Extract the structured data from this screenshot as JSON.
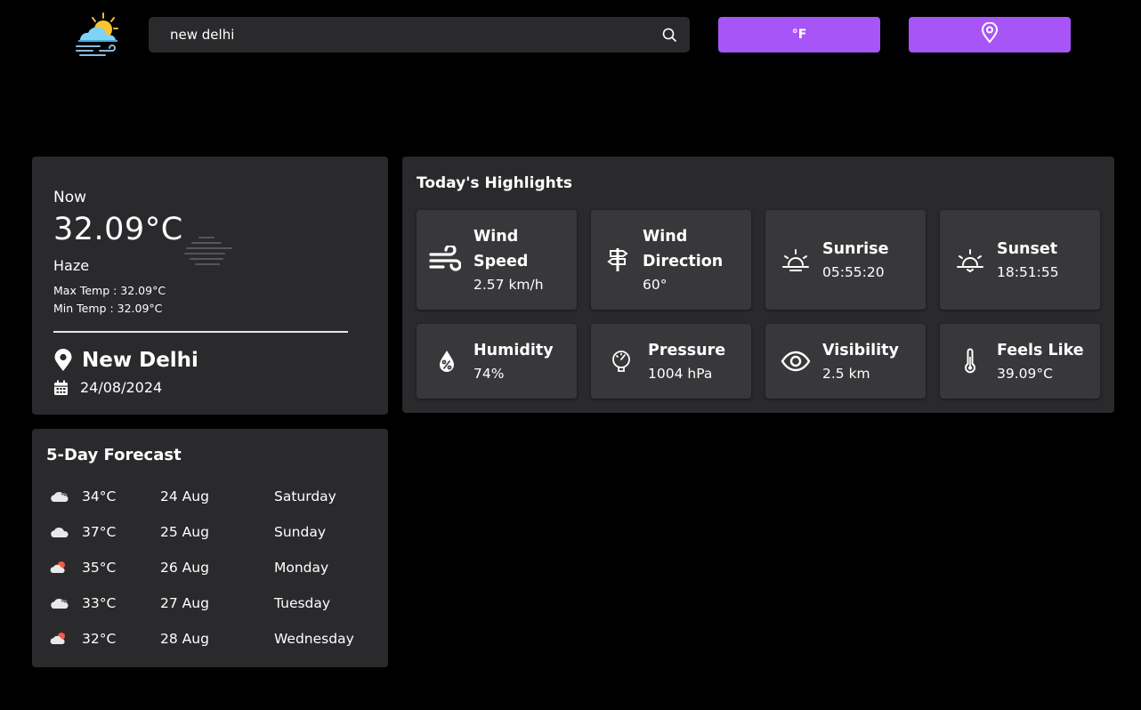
{
  "header": {
    "logo_icon": "weather-logo-icon",
    "search": {
      "value": "new delhi",
      "icon": "search-icon"
    },
    "unit_button_label": "°F",
    "location_button_icon": "map-pin-icon"
  },
  "current": {
    "now_label": "Now",
    "temperature": "32.09°C",
    "condition": "Haze",
    "condition_icon": "haze-icon",
    "max_temp": "Max Temp : 32.09°C",
    "min_temp": "Min Temp : 32.09°C",
    "city": "New Delhi",
    "date": "24/08/2024"
  },
  "forecast": {
    "title": "5-Day Forecast",
    "days": [
      {
        "icon": "cloud-icon",
        "temp": "34°C",
        "date": "24 Aug",
        "weekday": "Saturday"
      },
      {
        "icon": "cloud-icon",
        "temp": "37°C",
        "date": "25 Aug",
        "weekday": "Sunday"
      },
      {
        "icon": "cloud-sun-icon",
        "temp": "35°C",
        "date": "26 Aug",
        "weekday": "Monday"
      },
      {
        "icon": "cloud-icon",
        "temp": "33°C",
        "date": "27 Aug",
        "weekday": "Tuesday"
      },
      {
        "icon": "cloud-sun-icon",
        "temp": "32°C",
        "date": "28 Aug",
        "weekday": "Wednesday"
      }
    ]
  },
  "highlights": {
    "title": "Today's Highlights",
    "tiles": [
      {
        "icon": "wind-icon",
        "label_line1": "Wind",
        "label_line2": "Speed",
        "value": "2.57 km/h"
      },
      {
        "icon": "signpost-icon",
        "label_line1": "Wind",
        "label_line2": "Direction",
        "value": "60°"
      },
      {
        "icon": "sunrise-icon",
        "label": "Sunrise",
        "value": "05:55:20"
      },
      {
        "icon": "sunset-icon",
        "label": "Sunset",
        "value": "18:51:55"
      },
      {
        "icon": "humidity-icon",
        "label": "Humidity",
        "value": "74%"
      },
      {
        "icon": "gauge-icon",
        "label": "Pressure",
        "value": "1004 hPa"
      },
      {
        "icon": "eye-icon",
        "label": "Visibility",
        "value": "2.5 km"
      },
      {
        "icon": "thermometer-icon",
        "label": "Feels Like",
        "value": "39.09°C"
      }
    ]
  },
  "colors": {
    "background": "#000000",
    "card": "#2a2a2d",
    "tile": "#38383b",
    "accent": "#a855f7"
  }
}
